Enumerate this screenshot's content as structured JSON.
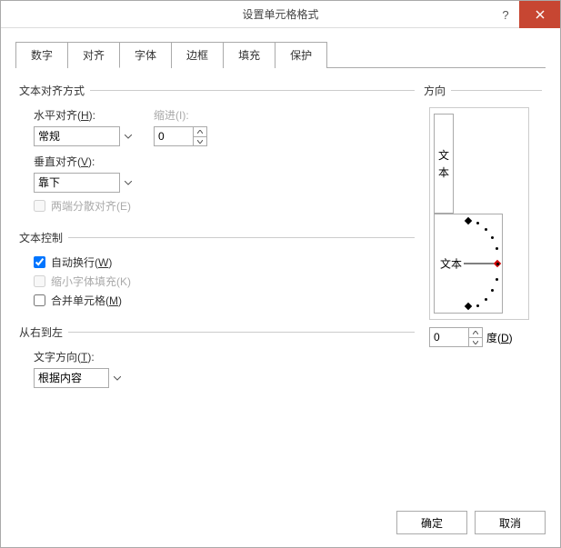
{
  "window": {
    "title": "设置单元格格式"
  },
  "tabs": {
    "number": "数字",
    "alignment": "对齐",
    "font": "字体",
    "border": "边框",
    "fill": "填充",
    "protection": "保护"
  },
  "groups": {
    "textAlign": "文本对齐方式",
    "textControl": "文本控制",
    "rtl": "从右到左",
    "orientation": "方向"
  },
  "labels": {
    "hAlign_pre": "水平对齐(",
    "hAlign_u": "H",
    "hAlign_post": "):",
    "vAlign_pre": "垂直对齐(",
    "vAlign_u": "V",
    "vAlign_post": "):",
    "indent_pre": "缩进(",
    "indent_u": "I",
    "indent_post": "):",
    "justify_pre": "两端分散对齐(",
    "justify_u": "E",
    "justify_post": ")",
    "wrap_pre": "自动换行(",
    "wrap_u": "W",
    "wrap_post": ")",
    "shrink_pre": "缩小字体填充(",
    "shrink_u": "K",
    "shrink_post": ")",
    "merge_pre": "合并单元格(",
    "merge_u": "M",
    "merge_post": ")",
    "textdir_pre": "文字方向(",
    "textdir_u": "T",
    "textdir_post": "):",
    "deg_pre": "度(",
    "deg_u": "D",
    "deg_post": ")"
  },
  "values": {
    "hAlign": "常规",
    "vAlign": "靠下",
    "indent": "0",
    "justifyChecked": false,
    "wrapChecked": true,
    "shrinkChecked": false,
    "mergeChecked": false,
    "textDirection": "根据内容",
    "degrees": "0",
    "orientVText1": "文",
    "orientVText2": "本",
    "orientDialText": "文本"
  },
  "buttons": {
    "ok": "确定",
    "cancel": "取消"
  }
}
